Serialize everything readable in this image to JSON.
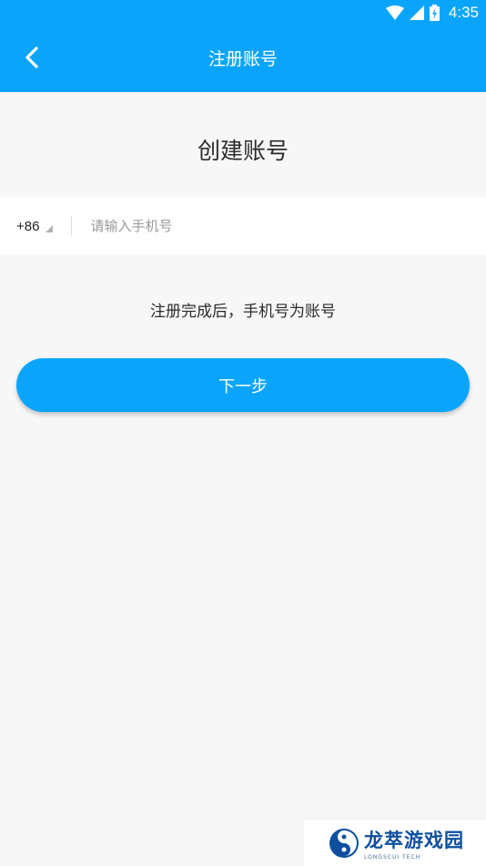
{
  "status_bar": {
    "time": "4:35",
    "icons": [
      "wifi-icon",
      "signal-icon",
      "battery-charging-icon"
    ]
  },
  "nav": {
    "title": "注册账号",
    "back_icon": "chevron-left-icon"
  },
  "heading": "创建账号",
  "phone": {
    "country_code": "+86",
    "placeholder": "请输入手机号",
    "value": ""
  },
  "hint": "注册完成后，手机号为账号",
  "next_button": "下一步",
  "watermark": {
    "name": "龙萃游戏园",
    "sub": "LONGSCUI TECH"
  },
  "colors": {
    "accent": "#0aa5fb",
    "background": "#f7f7f8"
  }
}
